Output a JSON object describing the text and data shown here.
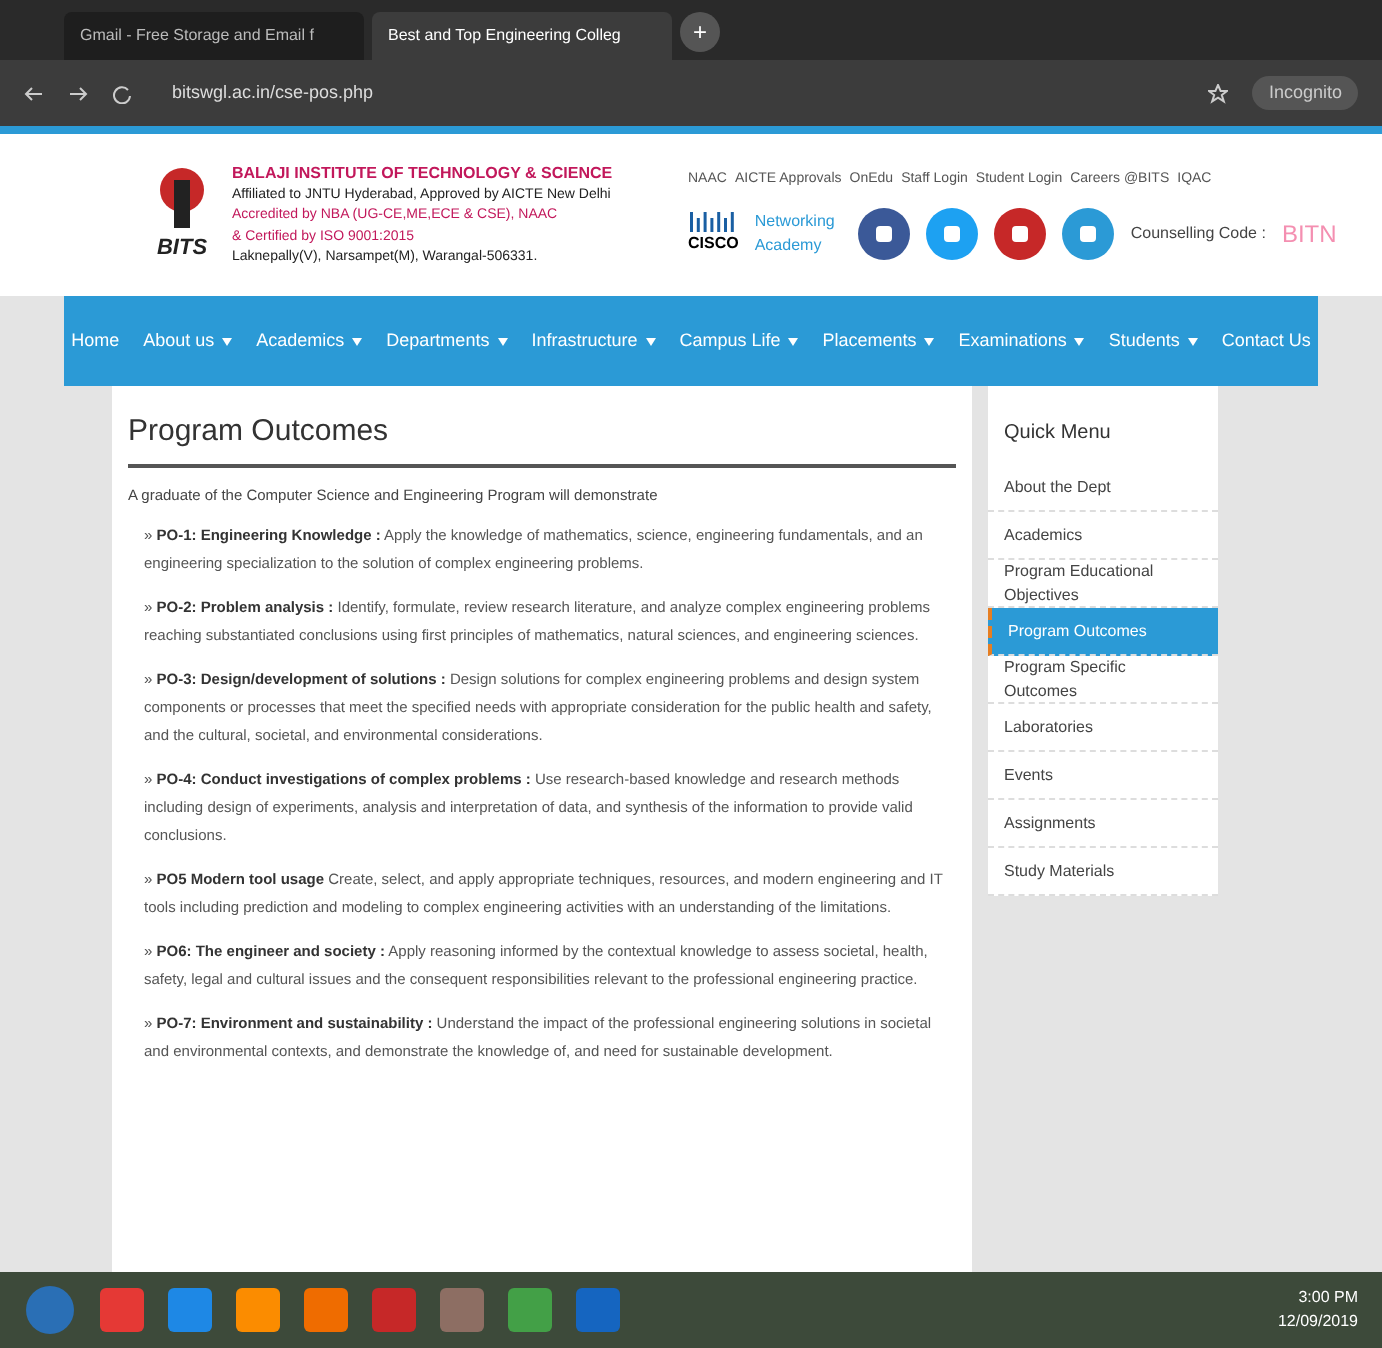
{
  "browser": {
    "tabs": [
      {
        "title": "Gmail - Free Storage and Email f",
        "selected": false
      },
      {
        "title": "Best and Top Engineering Colleg",
        "selected": true
      }
    ],
    "new_tab": "+",
    "address": "bitswgl.ac.in/cse-pos.php",
    "profile": "Incognito"
  },
  "header": {
    "logo_text": "BITS",
    "institute": "BALAJI INSTITUTE OF TECHNOLOGY & SCIENCE",
    "lines": [
      "Affiliated to JNTU Hyderabad, Approved by AICTE New Delhi",
      "Accredited by NBA (UG-CE,ME,ECE & CSE), NAAC",
      "& Certified by ISO 9001:2015",
      "Laknepally(V), Narsampet(M), Warangal-506331."
    ],
    "top_links": [
      "NAAC",
      "AICTE Approvals",
      "OnEdu",
      "Staff Login",
      "Student Login",
      "Careers @BITS",
      "IQAC"
    ],
    "cisco": "CISCO",
    "cisco_label": "Networking Academy",
    "counselling_label": "Counselling Code :",
    "counselling_code": "BITN"
  },
  "nav": [
    {
      "label": "Home",
      "dropdown": false
    },
    {
      "label": "About us",
      "dropdown": true
    },
    {
      "label": "Academics",
      "dropdown": true
    },
    {
      "label": "Departments",
      "dropdown": true
    },
    {
      "label": "Infrastructure",
      "dropdown": true
    },
    {
      "label": "Campus Life",
      "dropdown": true
    },
    {
      "label": "Placements",
      "dropdown": true
    },
    {
      "label": "Examinations",
      "dropdown": true
    },
    {
      "label": "Students",
      "dropdown": true
    },
    {
      "label": "Contact Us",
      "dropdown": false
    }
  ],
  "main": {
    "title": "Program Outcomes",
    "marker": "»",
    "intro": "A graduate of the Computer Science and Engineering Program will demonstrate",
    "outcomes": [
      {
        "label": "PO-1: Engineering Knowledge :",
        "text": "Apply the knowledge of mathematics, science, engineering fundamentals, and an engineering specialization to the solution of complex engineering problems."
      },
      {
        "label": "PO-2: Problem analysis :",
        "text": "Identify, formulate, review research literature, and analyze complex engineering problems reaching substantiated conclusions using first principles of mathematics, natural sciences, and engineering sciences."
      },
      {
        "label": "PO-3: Design/development of solutions :",
        "text": "Design solutions for complex engineering problems and design system components or processes that meet the specified needs with appropriate consideration for the public health and safety, and the cultural, societal, and environmental considerations."
      },
      {
        "label": "PO-4: Conduct investigations of complex problems :",
        "text": "Use research-based knowledge and research methods including design of experiments, analysis and interpretation of data, and synthesis of the information to provide valid conclusions."
      },
      {
        "label": "PO5 Modern tool usage",
        "text": "Create, select, and apply appropriate techniques, resources, and modern engineering and IT tools including prediction and modeling to complex engineering activities with an understanding of the limitations."
      },
      {
        "label": "PO6: The engineer and society :",
        "text": "Apply reasoning informed by the contextual knowledge to assess societal, health, safety, legal and cultural issues and the consequent responsibilities relevant to the professional engineering practice."
      },
      {
        "label": "PO-7: Environment and sustainability :",
        "text": "Understand the impact of the professional engineering solutions in societal and environmental contexts, and demonstrate the knowledge of, and need for sustainable development."
      }
    ]
  },
  "quick_menu": {
    "title": "Quick Menu",
    "items": [
      {
        "label": "About the Dept",
        "selected": false
      },
      {
        "label": "Academics",
        "selected": false
      },
      {
        "label": "Program Educational Objectives",
        "selected": false
      },
      {
        "label": "Program Outcomes",
        "selected": true
      },
      {
        "label": "Program Specific Outcomes",
        "selected": false
      },
      {
        "label": "Laboratories",
        "selected": false
      },
      {
        "label": "Events",
        "selected": false
      },
      {
        "label": "Assignments",
        "selected": false
      },
      {
        "label": "Study Materials",
        "selected": false
      }
    ]
  },
  "taskbar": {
    "time": "3:00 PM",
    "date": "12/09/2019"
  }
}
